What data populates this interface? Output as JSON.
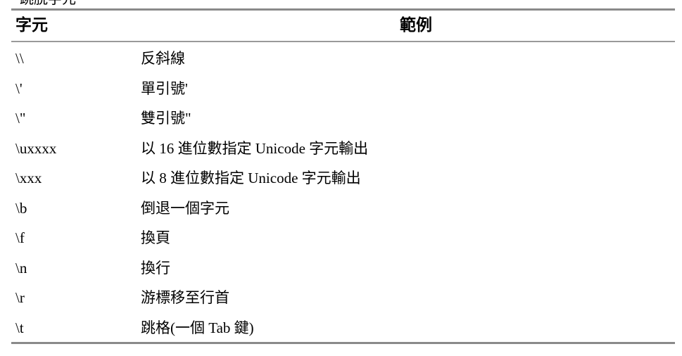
{
  "caption": "跳脫字元",
  "table": {
    "headers": {
      "character": "字元",
      "example": "範例"
    },
    "rows": [
      {
        "character": "\\\\",
        "example": "反斜線"
      },
      {
        "character": "\\'",
        "example": "單引號'"
      },
      {
        "character": "\\\"",
        "example": "雙引號\""
      },
      {
        "character": "\\uxxxx",
        "example": "以 16 進位數指定 Unicode 字元輸出"
      },
      {
        "character": "\\xxx",
        "example": "以 8 進位數指定 Unicode 字元輸出"
      },
      {
        "character": "\\b",
        "example": "倒退一個字元"
      },
      {
        "character": "\\f",
        "example": "換頁"
      },
      {
        "character": "\\n",
        "example": "換行"
      },
      {
        "character": "\\r",
        "example": "游標移至行首"
      },
      {
        "character": "\\t",
        "example": "跳格(一個 Tab 鍵)"
      }
    ]
  }
}
